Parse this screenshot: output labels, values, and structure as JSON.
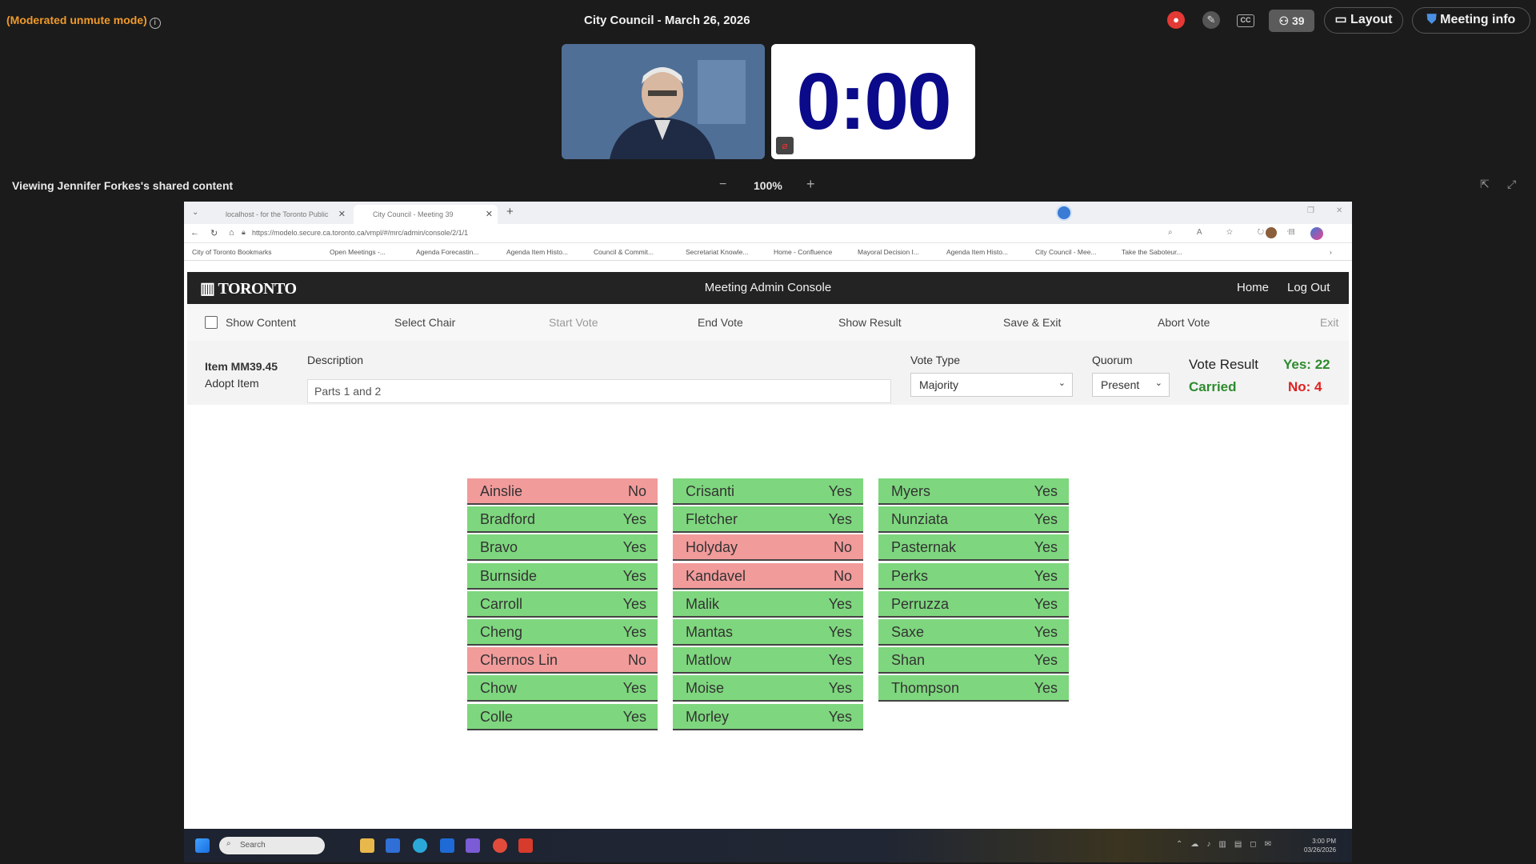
{
  "topbar": {
    "unmute_mode": "(Moderated unmute mode)",
    "info_icon": "info-icon",
    "meeting_title": "City Council - March 26, 2026",
    "participants_count": "39",
    "layout_label": "Layout",
    "meeting_info_label": "Meeting info"
  },
  "timer": {
    "value": "0:00"
  },
  "share": {
    "viewing_text": "Viewing Jennifer Forkes's shared content",
    "zoom_minus": "−",
    "zoom_level": "100%",
    "zoom_plus": "+"
  },
  "browser": {
    "tabs": [
      {
        "label": "localhost - for the Toronto Public"
      },
      {
        "label": "City Council - Meeting 39"
      }
    ],
    "new_tab": "+",
    "url": "https://modelo.secure.ca.toronto.ca/vmpl/#/mrc/admin/console/2/1/1",
    "bookmarks": [
      "City of Toronto Bookmarks",
      "Open Meetings -...",
      "Agenda Forecastin...",
      "Agenda Item Histo...",
      "Council & Commit...",
      "Secretariat Knowle...",
      "Home - Confluence",
      "Mayoral Decision I...",
      "Agenda Item Histo...",
      "City Council - Mee...",
      "Take the Saboteur..."
    ]
  },
  "console": {
    "logo_text": "TORONTO",
    "title": "Meeting Admin Console",
    "home": "Home",
    "logout": "Log Out",
    "toolbar": {
      "show_content": "Show Content",
      "select_chair": "Select Chair",
      "start_vote": "Start Vote",
      "end_vote": "End Vote",
      "show_result": "Show Result",
      "save_exit": "Save & Exit",
      "abort_vote": "Abort Vote",
      "exit": "Exit"
    },
    "item": {
      "number": "Item MM39.45",
      "action": "Adopt Item",
      "description_label": "Description",
      "description_value": "Parts 1 and 2",
      "vote_type_label": "Vote Type",
      "vote_type_value": "Majority",
      "quorum_label": "Quorum",
      "quorum_value": "Present",
      "vote_result_label": "Vote Result",
      "vote_result_value": "Carried",
      "yes_total": "Yes: 22",
      "no_total": "No: 4"
    },
    "votes": [
      [
        {
          "name": "Ainslie",
          "vote": "No"
        },
        {
          "name": "Bradford",
          "vote": "Yes"
        },
        {
          "name": "Bravo",
          "vote": "Yes"
        },
        {
          "name": "Burnside",
          "vote": "Yes"
        },
        {
          "name": "Carroll",
          "vote": "Yes"
        },
        {
          "name": "Cheng",
          "vote": "Yes"
        },
        {
          "name": "Chernos Lin",
          "vote": "No"
        },
        {
          "name": "Chow",
          "vote": "Yes"
        },
        {
          "name": "Colle",
          "vote": "Yes"
        }
      ],
      [
        {
          "name": "Crisanti",
          "vote": "Yes"
        },
        {
          "name": "Fletcher",
          "vote": "Yes"
        },
        {
          "name": "Holyday",
          "vote": "No"
        },
        {
          "name": "Kandavel",
          "vote": "No"
        },
        {
          "name": "Malik",
          "vote": "Yes"
        },
        {
          "name": "Mantas",
          "vote": "Yes"
        },
        {
          "name": "Matlow",
          "vote": "Yes"
        },
        {
          "name": "Moise",
          "vote": "Yes"
        },
        {
          "name": "Morley",
          "vote": "Yes"
        }
      ],
      [
        {
          "name": "Myers",
          "vote": "Yes"
        },
        {
          "name": "Nunziata",
          "vote": "Yes"
        },
        {
          "name": "Pasternak",
          "vote": "Yes"
        },
        {
          "name": "Perks",
          "vote": "Yes"
        },
        {
          "name": "Perruzza",
          "vote": "Yes"
        },
        {
          "name": "Saxe",
          "vote": "Yes"
        },
        {
          "name": "Shan",
          "vote": "Yes"
        },
        {
          "name": "Thompson",
          "vote": "Yes"
        }
      ]
    ]
  },
  "taskbar": {
    "search_placeholder": "Search",
    "time": "3:00 PM",
    "date": "03/26/2026"
  },
  "colors": {
    "yes_bg": "#7ed77e",
    "no_bg": "#f29b9b",
    "carried": "#2e8b2e",
    "no_count": "#e02020",
    "unmute": "#f09a2a",
    "timer": "#0a0a8a"
  }
}
